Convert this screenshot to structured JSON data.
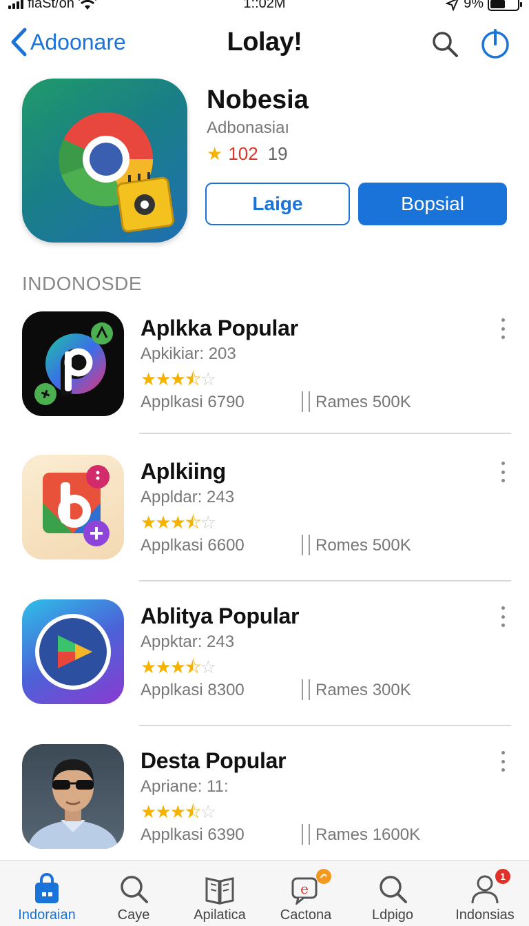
{
  "status": {
    "carrier": "fiaSt/on",
    "time": "1::02M",
    "battery_text": "9%",
    "battery_level": 0.55
  },
  "nav": {
    "back_label": "Adoonare",
    "title": "Lolay!"
  },
  "hero": {
    "name": "Nobesia",
    "subtitle": "Adbonasiaı",
    "rating": "102",
    "rating_count": "19",
    "button_secondary": "Laige",
    "button_primary": "Bopsial"
  },
  "section": {
    "title": "INDONOSDE"
  },
  "apps": [
    {
      "title": "Aplkka Popular",
      "subtitle": "Apkikiar: 203",
      "stars": 3.5,
      "meta_left": "Applkasi 6790",
      "meta_right": "Rames 500K",
      "icon": "p-logo-icon"
    },
    {
      "title": "Aplkiing",
      "subtitle": "Appldar: 243",
      "stars": 3.5,
      "meta_left": "Applkasi 6600",
      "meta_right": "Romes 500K",
      "icon": "b-logo-icon"
    },
    {
      "title": "Ablitya Popular",
      "subtitle": "Appktar: 243",
      "stars": 3.5,
      "meta_left": "Applkasi 8300",
      "meta_right": "Rames 300K",
      "icon": "play-logo-icon"
    },
    {
      "title": "Desta Popular",
      "subtitle": "Apriane: 11:",
      "stars": 3.5,
      "meta_left": "Applkasi 6390",
      "meta_right": "Rames 1600K",
      "icon": "avatar-photo-icon"
    }
  ],
  "tabs": [
    {
      "label": "Indoraian",
      "icon": "shopping-bag-icon",
      "active": true
    },
    {
      "label": "Caye",
      "icon": "search-icon"
    },
    {
      "label": "Apilatica",
      "icon": "book-icon"
    },
    {
      "label": "Cactona",
      "icon": "chat-icon",
      "badge_color": "#f29a1f"
    },
    {
      "label": "Ldpigo",
      "icon": "search-icon"
    },
    {
      "label": "Indonsias",
      "icon": "person-icon",
      "badge": "1",
      "badge_color": "#e0312b"
    }
  ],
  "colors": {
    "accent": "#1a73d9",
    "star": "#f5b300",
    "rating_red": "#d8382c"
  }
}
